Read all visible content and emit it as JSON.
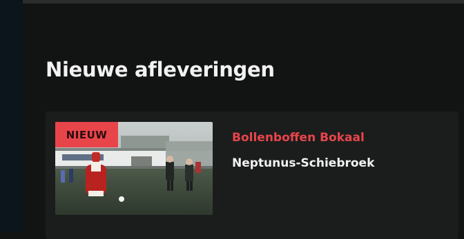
{
  "section": {
    "title": "Nieuwe afleveringen"
  },
  "episodes": [
    {
      "badge": "NIEUW",
      "series": "Bollenboffen Bokaal",
      "title": "Neptunus-Schiebroek",
      "thumbnail": "football-match-with-sinterklaas"
    }
  ],
  "colors": {
    "accent": "#e8454b",
    "badge_bg": "#e8454b",
    "badge_text": "#2a0d0e",
    "background": "#121413",
    "card": "#1b1d1c"
  }
}
